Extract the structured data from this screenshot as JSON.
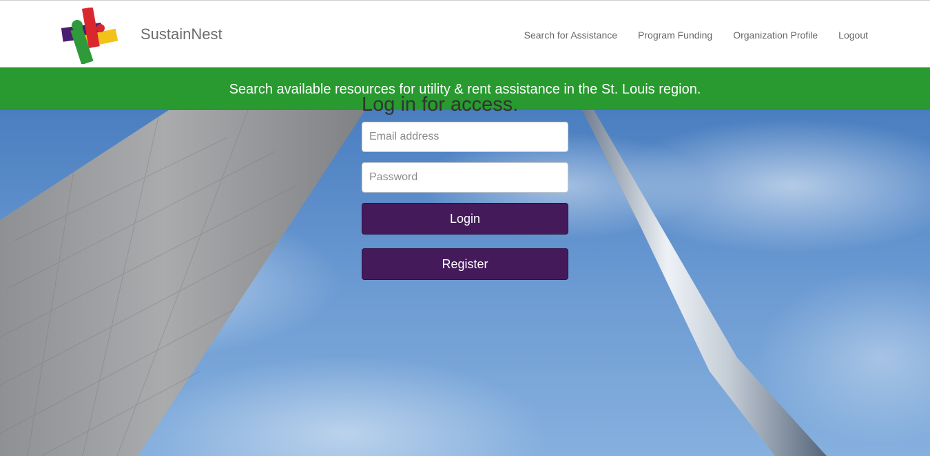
{
  "header": {
    "brand": "SustainNest",
    "nav": [
      {
        "label": "Search for Assistance"
      },
      {
        "label": "Program Funding"
      },
      {
        "label": "Organization Profile"
      },
      {
        "label": "Logout"
      }
    ]
  },
  "banner": {
    "text": "Search available resources for utility & rent assistance in the St. Louis region."
  },
  "login": {
    "heading": "Log in for access.",
    "email_placeholder": "Email address",
    "password_placeholder": "Password",
    "login_label": "Login",
    "register_label": "Register"
  },
  "colors": {
    "banner": "#289a2f",
    "button": "#451a5b"
  }
}
